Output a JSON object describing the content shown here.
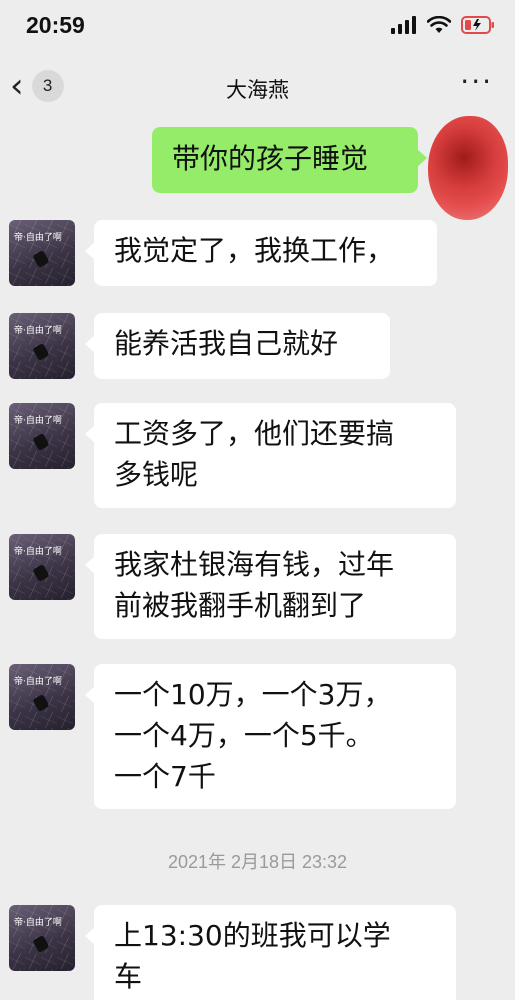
{
  "status": {
    "time": "20:59"
  },
  "nav": {
    "back_icon": "chevron-left-icon",
    "unread_count": "3",
    "title": "大海燕",
    "more_icon": "more-icon"
  },
  "messages": [
    {
      "side": "sent",
      "text": "带你的孩子睡觉"
    },
    {
      "side": "received",
      "text": "我觉定了，我换工作，"
    },
    {
      "side": "received",
      "text": "能养活我自己就好"
    },
    {
      "side": "received",
      "lines": [
        "工资多了，他们还要搞",
        "多钱呢"
      ]
    },
    {
      "side": "received",
      "lines": [
        "我家杜银海有钱，过年",
        "前被我翻手机翻到了"
      ]
    },
    {
      "side": "received",
      "lines": [
        "一个10万，一个3万，",
        "一个4万，一个5千。",
        "一个7千"
      ]
    },
    {
      "side": "received",
      "lines": [
        "上13:30的班我可以学",
        "车"
      ]
    }
  ],
  "timestamp": "2021年 2月18日 23:32",
  "colors": {
    "background": "#ededed",
    "sent_bubble": "#95ec69",
    "received_bubble": "#ffffff",
    "timestamp_text": "#9a9a9a"
  }
}
